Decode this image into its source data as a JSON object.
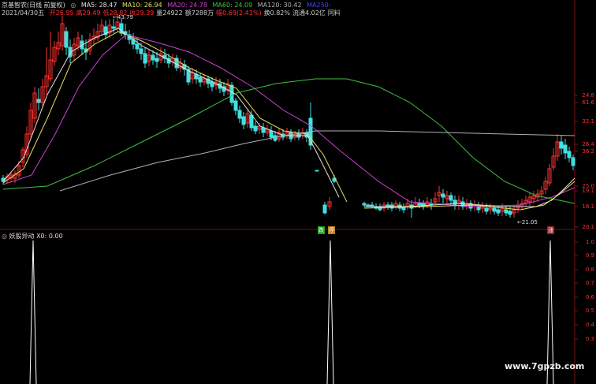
{
  "header": {
    "title": "京基智农(日线 前复权)",
    "ma": [
      {
        "label": "MA5: 28.47",
        "color": "#e0e0e0"
      },
      {
        "label": "MA10: 26.94",
        "color": "#e8e060"
      },
      {
        "label": "MA20: 24.78",
        "color": "#d040d0"
      },
      {
        "label": "MA60: 24.09",
        "color": "#40c040"
      },
      {
        "label": "MA120: 30.42",
        "color": "#b0b0b0"
      },
      {
        "label": "MA250:",
        "color": "#4040ff"
      }
    ],
    "date": "2021/04/30五",
    "fields": [
      {
        "label": "开",
        "value": "26.95",
        "color": "#ff3030"
      },
      {
        "label": "高",
        "value": "29.49",
        "color": "#ff3030"
      },
      {
        "label": "低",
        "value": "28.82",
        "color": "#ff3030"
      },
      {
        "label": "收",
        "value": "29.39",
        "color": "#ff3030"
      },
      {
        "label": "量",
        "value": "24922",
        "color": "#ccc"
      },
      {
        "label": "额",
        "value": "7288万",
        "color": "#ccc"
      },
      {
        "label": "幅",
        "value": "0.69(2.41%)",
        "color": "#ff3030"
      },
      {
        "label": "换",
        "value": "0.82%",
        "color": "#ccc"
      },
      {
        "label": "流通",
        "value": "4.02亿",
        "color": "#ccc"
      },
      {
        "label": "",
        "value": "同料",
        "color": "#ccc"
      }
    ]
  },
  "main_axis": [
    "24.8",
    "61.6",
    "32.1",
    "26.4",
    "36.2",
    "25.0",
    "19.1",
    "16.1",
    "20.1"
  ],
  "annotations": {
    "high": "43.79",
    "low": "21.05",
    "tag1": "跌",
    "tag2": "停",
    "tag3": "涨"
  },
  "indicator": {
    "label": "妖股异动 X0: 0.00",
    "axis": [
      "1.0",
      "0.9",
      "0.8",
      "0.7",
      "0.6",
      "0.5",
      "0.4",
      "0.3"
    ]
  },
  "watermark": "www.7gpzb.com",
  "colors": {
    "up": "#ff3030",
    "down": "#40e0e0",
    "ma5": "#e0e0e0",
    "ma10": "#e8e060",
    "ma20": "#d040d0",
    "ma60": "#40c040",
    "ma120": "#b0b0b0",
    "grid": "#801010"
  }
}
